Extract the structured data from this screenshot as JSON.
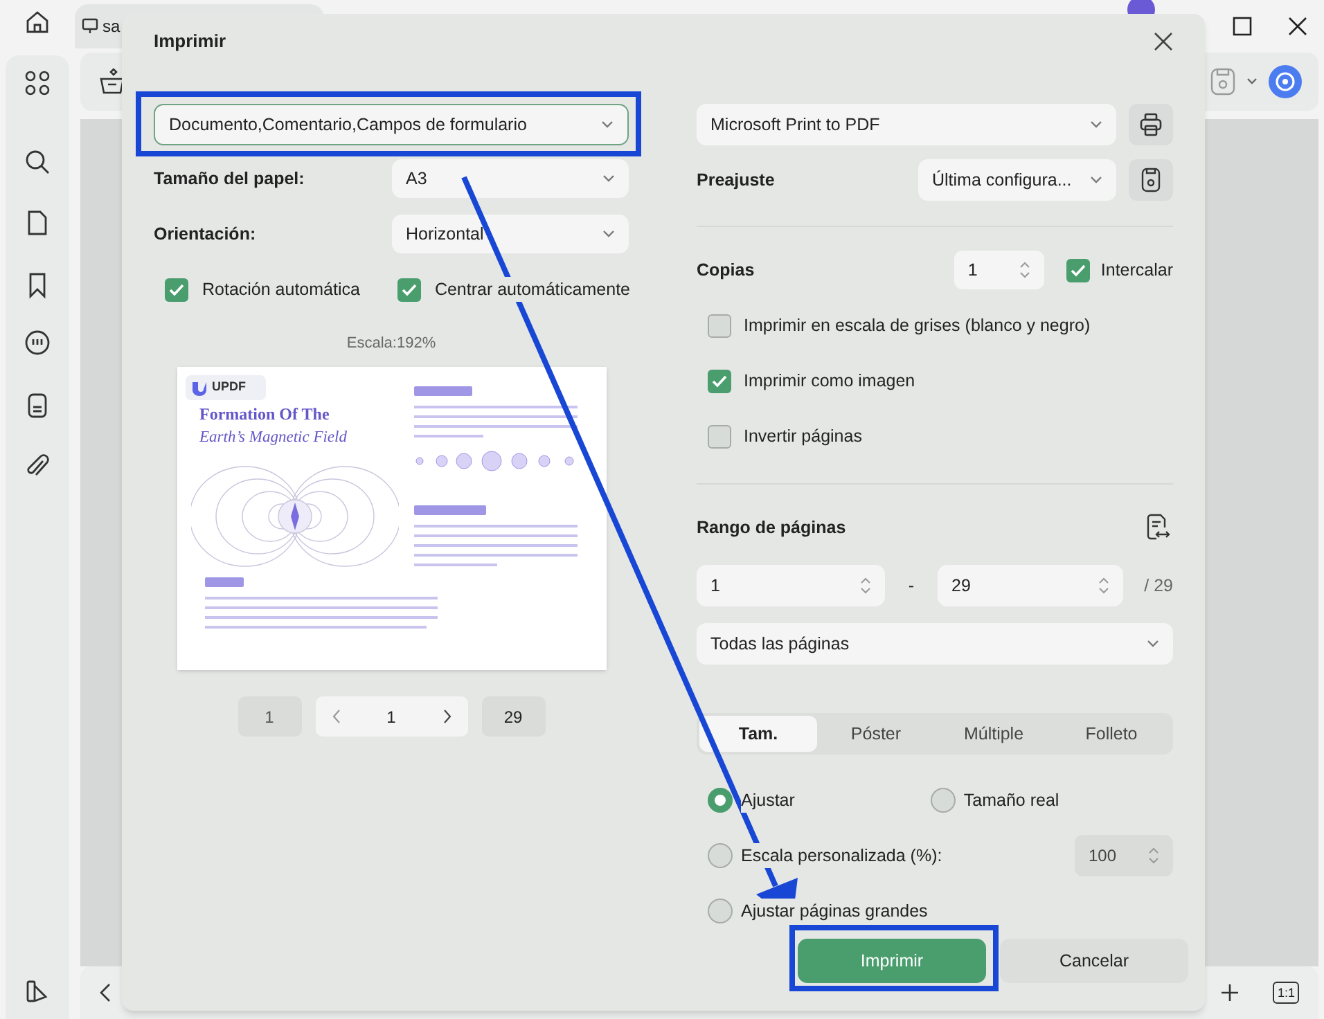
{
  "app": {
    "tab_title": "sa",
    "zoom_reset": "1:1"
  },
  "dialog": {
    "title": "Imprimir",
    "content_select": "Documento,Comentario,Campos de formulario",
    "paper_size": {
      "label": "Tamaño del papel:",
      "value": "A3"
    },
    "orientation": {
      "label": "Orientación:",
      "value": "Horizontal"
    },
    "layout_options": [
      {
        "label": "Rotación automática",
        "checked": true
      },
      {
        "label": "Centrar automáticamente",
        "checked": true
      }
    ],
    "scale_text": "Escala:192%",
    "preview": {
      "logo": "UPDF",
      "title_1": "Formation Of The",
      "title_2": "Earth’s Magnetic Field"
    },
    "pager": {
      "first": "1",
      "current": "1",
      "last": "29"
    },
    "printer": "Microsoft Print to PDF",
    "preset": {
      "label": "Preajuste",
      "value": "Última configura..."
    },
    "copies": {
      "label": "Copias",
      "value": "1",
      "collate_label": "Intercalar",
      "collate_checked": true
    },
    "print_options": [
      {
        "label": "Imprimir en escala de grises (blanco y negro)",
        "checked": false
      },
      {
        "label": "Imprimir como imagen",
        "checked": true
      },
      {
        "label": "Invertir páginas",
        "checked": false
      }
    ],
    "page_range": {
      "label": "Rango de páginas",
      "from": "1",
      "separator": "-",
      "to": "29",
      "total": "/ 29",
      "subset": "Todas las páginas"
    },
    "tabs": [
      {
        "label": "Tam.",
        "selected": true
      },
      {
        "label": "Póster",
        "selected": false
      },
      {
        "label": "Múltiple",
        "selected": false
      },
      {
        "label": "Folleto",
        "selected": false
      }
    ],
    "scaling": [
      {
        "label": "Ajustar",
        "selected": true
      },
      {
        "label": "Tamaño real",
        "selected": false
      },
      {
        "label": "Escala personalizada (%):",
        "selected": false,
        "value": "100"
      },
      {
        "label": "Ajustar páginas grandes",
        "selected": false
      }
    ],
    "buttons": [
      {
        "label": "Imprimir",
        "kind": "primary"
      },
      {
        "label": "Cancelar",
        "kind": "secondary"
      }
    ]
  }
}
